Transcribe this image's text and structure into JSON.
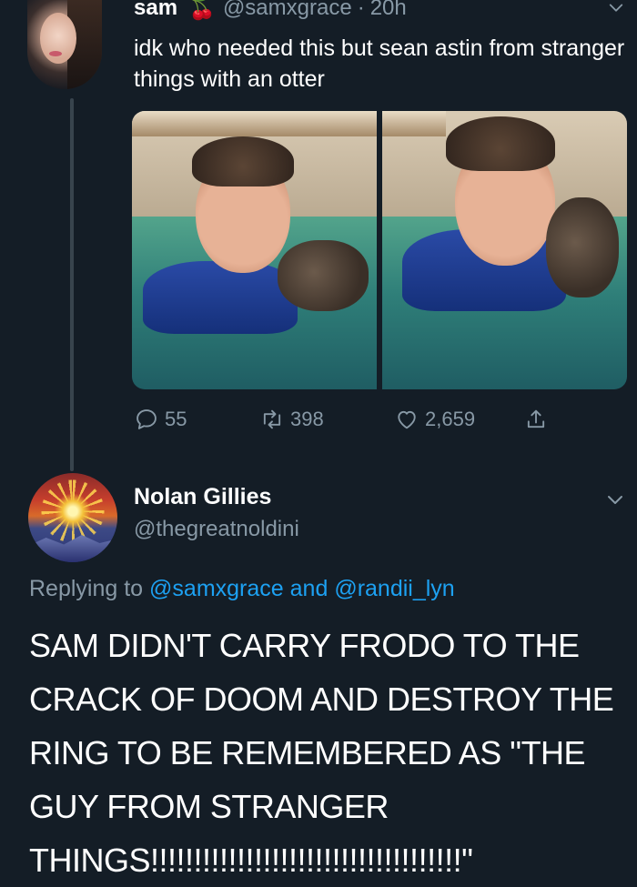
{
  "tweet": {
    "author_name": "sam",
    "author_emoji": "🍒",
    "handle": "@samxgrace",
    "separator": "·",
    "time": "20h",
    "text": "idk who needed this but sean astin from stranger things with an otter",
    "stats": {
      "replies": "55",
      "retweets": "398",
      "likes": "2,659"
    }
  },
  "reply": {
    "author_name": "Nolan Gillies",
    "handle": "@thegreatnoldini",
    "replying_prefix": "Replying to",
    "mention_1": "@samxgrace",
    "conjunction": "and",
    "mention_2": "@randii_lyn",
    "text": "SAM DIDN'T CARRY FRODO TO THE CRACK OF DOOM AND DESTROY THE RING TO BE REMEMBERED AS \"THE GUY FROM STRANGER THINGS!!!!!!!!!!!!!!!!!!!!!!!!!!!!!!!!!!!!\""
  },
  "colors": {
    "background": "#141d26",
    "secondary_text": "#8899a6",
    "link": "#1da1f2",
    "thread_line": "#38444d"
  },
  "icons": [
    "chevron-down-icon",
    "reply-icon",
    "retweet-icon",
    "like-icon",
    "share-icon",
    "cherry-emoji"
  ]
}
